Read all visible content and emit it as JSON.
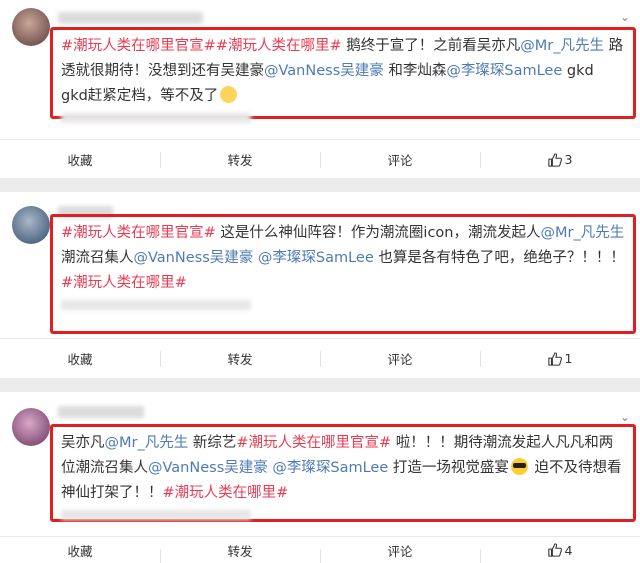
{
  "posts": [
    {
      "text": [
        {
          "t": "tag",
          "v": "#潮玩人类在哪里官宣#"
        },
        {
          "t": "tag",
          "v": "#潮玩人类在哪里#"
        },
        {
          "t": "txt",
          "v": " 鹅终于宣了！之前看吴亦凡"
        },
        {
          "t": "at",
          "v": "@Mr_凡先生"
        },
        {
          "t": "txt",
          "v": " 路透就很期待！没想到还有吴建豪"
        },
        {
          "t": "at",
          "v": "@VanNess吴建豪"
        },
        {
          "t": "txt",
          "v": " 和李灿森"
        },
        {
          "t": "at",
          "v": "@李璨琛SamLee"
        },
        {
          "t": "txt",
          "v": " gkd gkd赶紧定档，等不及了"
        },
        {
          "t": "emoji",
          "v": "sleepy-face"
        }
      ],
      "actions": {
        "favorite": "收藏",
        "repost": "转发",
        "comment": "评论",
        "like_count": "3"
      }
    },
    {
      "text": [
        {
          "t": "tag",
          "v": "#潮玩人类在哪里官宣#"
        },
        {
          "t": "txt",
          "v": " 这是什么神仙阵容！作为潮流圈icon，潮流发起人"
        },
        {
          "t": "at",
          "v": "@Mr_凡先生"
        },
        {
          "t": "txt",
          "v": " 潮流召集人"
        },
        {
          "t": "at",
          "v": "@VanNess吴建豪"
        },
        {
          "t": "txt",
          "v": " "
        },
        {
          "t": "at",
          "v": "@李璨琛SamLee"
        },
        {
          "t": "txt",
          "v": " 也算是各有特色了吧，绝绝子？！！！"
        },
        {
          "t": "tag",
          "v": "#潮玩人类在哪里#"
        }
      ],
      "actions": {
        "favorite": "收藏",
        "repost": "转发",
        "comment": "评论",
        "like_count": "1"
      }
    },
    {
      "text": [
        {
          "t": "txt",
          "v": "吴亦凡"
        },
        {
          "t": "at",
          "v": "@Mr_凡先生"
        },
        {
          "t": "txt",
          "v": " 新综艺"
        },
        {
          "t": "tag",
          "v": "#潮玩人类在哪里官宣#"
        },
        {
          "t": "txt",
          "v": " 啦！！！期待潮流发起人凡凡和两位潮流召集人"
        },
        {
          "t": "at",
          "v": "@VanNess吴建豪"
        },
        {
          "t": "txt",
          "v": " "
        },
        {
          "t": "at",
          "v": "@李璨琛SamLee"
        },
        {
          "t": "txt",
          "v": " 打造一场视觉盛宴"
        },
        {
          "t": "emoji",
          "v": "sunglasses-face"
        },
        {
          "t": "txt",
          "v": " 迫不及待想看神仙打架了！！"
        },
        {
          "t": "tag",
          "v": "#潮玩人类在哪里#"
        }
      ],
      "actions": {
        "favorite": "收藏",
        "repost": "转发",
        "comment": "评论",
        "like_count": "4"
      }
    }
  ],
  "colors": {
    "hashtag": "#eb3b51",
    "mention": "#4e7bb6",
    "highlight_box": "#e02020"
  }
}
